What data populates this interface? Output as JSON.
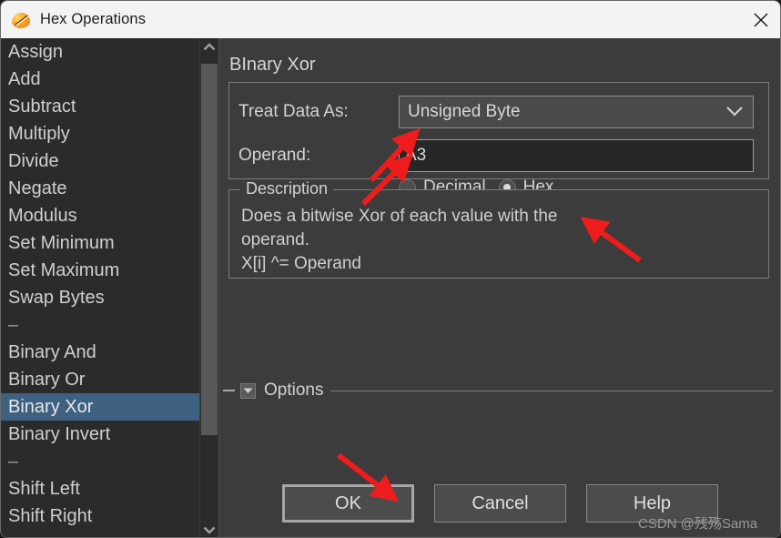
{
  "window": {
    "title": "Hex Operations",
    "app_icon": "hex-operations-icon",
    "close_icon": "close-icon"
  },
  "operation_list": {
    "scroll_up_icon": "chevron-up-icon",
    "scroll_down_icon": "chevron-down-icon",
    "selected": "Binary Xor",
    "items": [
      {
        "label": "Assign",
        "separator": false
      },
      {
        "label": "Add",
        "separator": false
      },
      {
        "label": "Subtract",
        "separator": false
      },
      {
        "label": "Multiply",
        "separator": false
      },
      {
        "label": "Divide",
        "separator": false
      },
      {
        "label": "Negate",
        "separator": false
      },
      {
        "label": "Modulus",
        "separator": false
      },
      {
        "label": "Set Minimum",
        "separator": false
      },
      {
        "label": "Set Maximum",
        "separator": false
      },
      {
        "label": "Swap Bytes",
        "separator": false
      },
      {
        "label": "–",
        "separator": true
      },
      {
        "label": "Binary And",
        "separator": false
      },
      {
        "label": "Binary Or",
        "separator": false
      },
      {
        "label": "Binary Xor",
        "separator": false
      },
      {
        "label": "Binary Invert",
        "separator": false
      },
      {
        "label": "–",
        "separator": true
      },
      {
        "label": "Shift Left",
        "separator": false
      },
      {
        "label": "Shift Right",
        "separator": false
      }
    ]
  },
  "panel": {
    "title": "BInary Xor",
    "treat_data_as": {
      "label": "Treat Data As:",
      "value": "Unsigned Byte",
      "chevron_icon": "chevron-down-icon"
    },
    "operand": {
      "label": "Operand:",
      "value": "A3",
      "placeholder": ""
    },
    "base_radios": [
      {
        "label": "Decimal",
        "checked": false
      },
      {
        "label": "Hex",
        "checked": true
      }
    ],
    "description": {
      "legend": "Description",
      "line1": "Does a bitwise Xor of each value with the",
      "line2": "operand.",
      "line3": "X[i] ^= Operand"
    },
    "options": {
      "label": "Options",
      "toggle_icon": "collapse-toggle-icon",
      "expanded": false
    }
  },
  "buttons": {
    "ok": "OK",
    "cancel": "Cancel",
    "help": "Help"
  },
  "watermark": "CSDN @残殇Sama",
  "colors": {
    "selection": "#3e6181",
    "panel_bg": "#3c3c3c",
    "list_bg": "#2b2b2b",
    "annotation_red": "#ee1c1c",
    "titlebar_bg": "#f3f3f3"
  }
}
